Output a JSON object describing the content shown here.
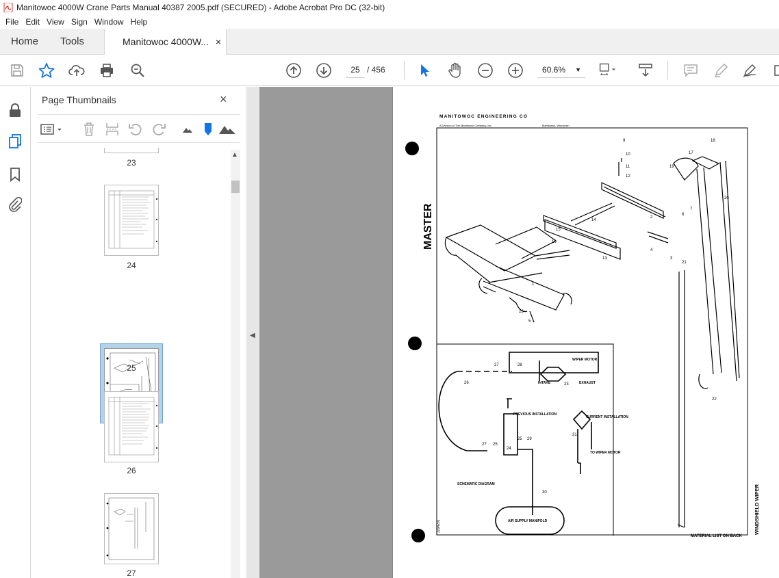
{
  "window": {
    "title": "Manitowoc 4000W Crane Parts Manual 40387 2005.pdf (SECURED) - Adobe Acrobat Pro DC (32-bit)"
  },
  "menu": {
    "items": [
      "File",
      "Edit",
      "View",
      "Sign",
      "Window",
      "Help"
    ]
  },
  "tabs": {
    "home": "Home",
    "tools": "Tools",
    "doc": "Manitowoc 4000W...",
    "close": "×"
  },
  "toolbar": {
    "current_page": "25",
    "total_pages": "/ 456",
    "zoom": "60.6%",
    "zoom_caret": "▼"
  },
  "panel": {
    "title": "Page Thumbnails",
    "close": "×",
    "thumbnails": [
      {
        "label": "23"
      },
      {
        "label": "24"
      },
      {
        "label": "25",
        "selected": true
      },
      {
        "label": "26"
      },
      {
        "label": "27"
      }
    ]
  },
  "document": {
    "header": "MANITOWOC ENGINEERING CO",
    "subheader_left": "A Division of The Manitowoc Company, Inc.",
    "subheader_right": "Manitowoc, Wisconsin",
    "side_title": "MASTER",
    "bottom_title": "WINDSHIELD WIPER",
    "material_note": "MATERIAL LIST ON BACK",
    "schematic_label": "SCHEMATIC DIAGRAM",
    "wiper_motor": "WIPER MOTOR",
    "intake": "INTAKE",
    "exhaust": "EXHAUST",
    "previous_installation": "PREVIOUS INSTALLATION",
    "current_installation": "CURRENT INSTALLATION",
    "to_wiper_motor": "TO WIPER MOTOR",
    "air_supply": "AIR SUPPLY MANIFOLD",
    "drawing_no": "3294201"
  },
  "colors": {
    "accent": "#1473e6",
    "doc_bg": "#9a9a9a",
    "selection": "#b4d2ea"
  }
}
